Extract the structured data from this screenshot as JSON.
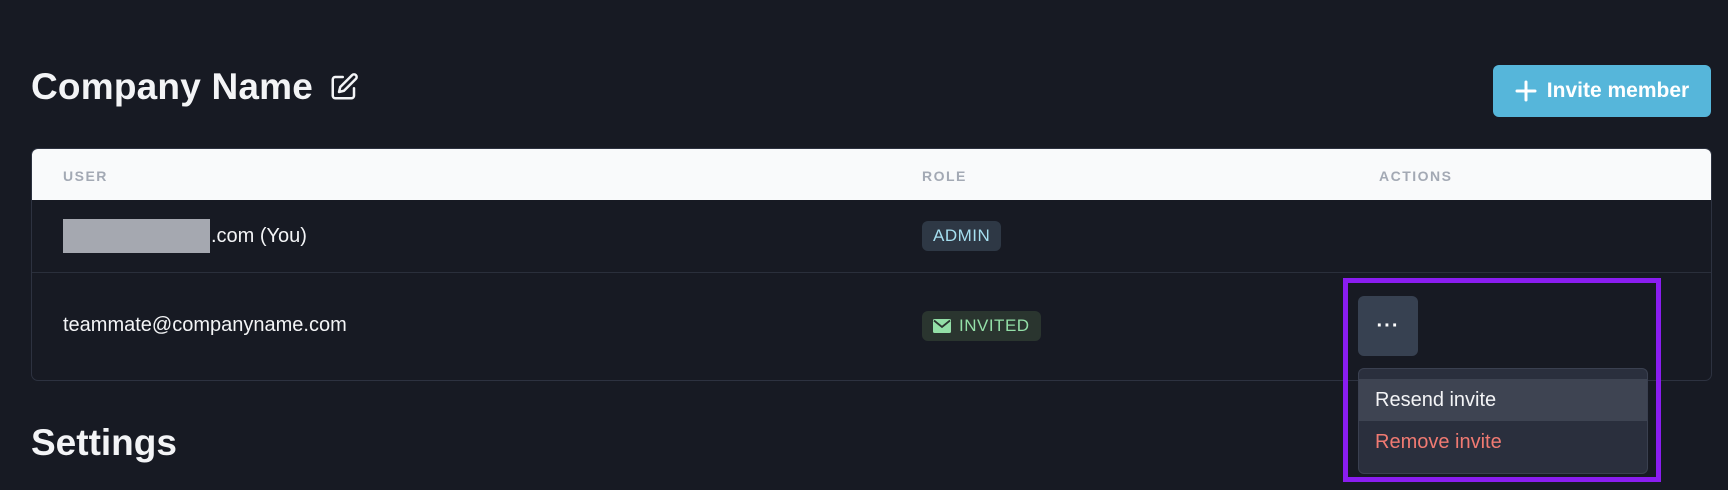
{
  "header": {
    "company_name": "Company Name",
    "edit_icon": "edit-icon",
    "invite_button_label": "Invite member",
    "invite_icon": "plus-icon"
  },
  "table": {
    "columns": [
      "USER",
      "ROLE",
      "ACTIONS"
    ],
    "rows": [
      {
        "user_suffix": ".com (You)",
        "role": "ADMIN"
      },
      {
        "user": "teammate@companyname.com",
        "role": "INVITED",
        "role_icon": "envelope-icon"
      }
    ]
  },
  "actions_menu": {
    "trigger_label": "···",
    "items": [
      "Resend invite",
      "Remove invite"
    ]
  },
  "settings": {
    "title": "Settings"
  },
  "colors": {
    "background": "#171a23",
    "accent": "#56b6da",
    "highlight": "#8a1df0",
    "danger": "#f07a72"
  }
}
